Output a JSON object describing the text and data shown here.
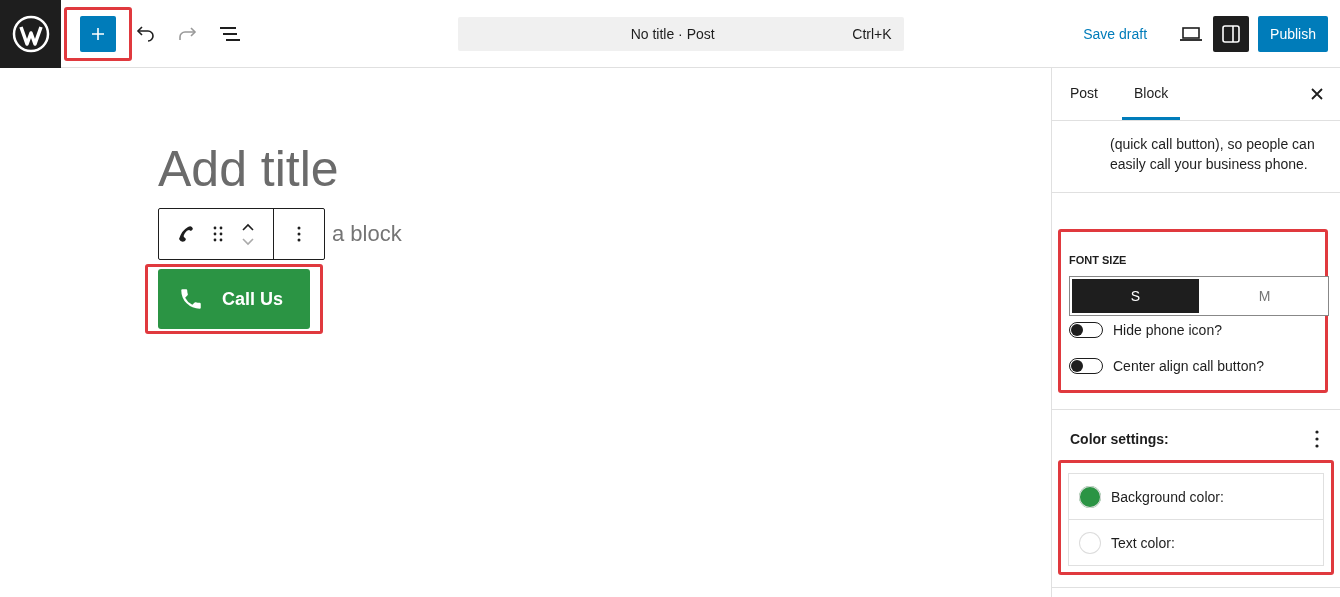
{
  "toolbar": {
    "command_bar": {
      "title": "No title · Post",
      "shortcut": "Ctrl+K"
    },
    "save_label": "Save draft",
    "publish_label": "Publish",
    "settings_on": true,
    "inserter_highlighted": true
  },
  "editor": {
    "title_placeholder": "Add title",
    "paragraph_hint": "a block",
    "call_button": {
      "label": "Call Us",
      "color": "#2b9444",
      "highlighted": true
    }
  },
  "sidebar": {
    "tabs": [
      {
        "label": "Post",
        "selected": false
      },
      {
        "label": "Block",
        "selected": true
      }
    ],
    "description_lines": [
      "(quick call button), so people can",
      "easily call your business phone."
    ],
    "font_size": {
      "label": "FONT SIZE",
      "highlighted": true,
      "options": [
        {
          "label": "S",
          "selected": true
        },
        {
          "label": "M",
          "selected": false
        }
      ]
    },
    "toggles": [
      {
        "label": "Hide phone icon?",
        "checked": false
      },
      {
        "label": "Center align call button?",
        "checked": false
      }
    ],
    "color_settings": {
      "title": "Color settings:",
      "highlighted": true,
      "items": [
        {
          "label": "Background color:",
          "color": "#2b9444"
        },
        {
          "label": "Text color:",
          "color": "#ffffff"
        }
      ]
    }
  }
}
